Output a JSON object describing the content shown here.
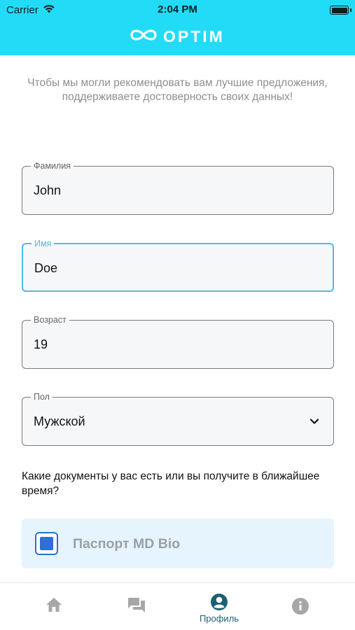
{
  "status_bar": {
    "carrier": "Carrier",
    "time": "2:04 PM"
  },
  "header": {
    "logo_text": "OPTIM"
  },
  "intro_text": "Чтобы мы могли рекомендовать вам лучшие предложения, поддерживаете достоверность своих данных!",
  "fields": {
    "surname": {
      "label": "Фамилия",
      "value": "John"
    },
    "name": {
      "label": "Имя",
      "value": "Doe"
    },
    "age": {
      "label": "Возраст",
      "value": "19"
    },
    "gender": {
      "label": "Пол",
      "value": "Мужской"
    }
  },
  "documents": {
    "question": "Какие документы у вас есть или вы получите в ближайшее время?",
    "items": [
      {
        "label": "Паспорт MD Bio",
        "checked": true
      }
    ]
  },
  "tabbar": {
    "items": [
      {
        "icon": "home-icon",
        "label": ""
      },
      {
        "icon": "chat-icon",
        "label": ""
      },
      {
        "icon": "profile-icon",
        "label": "Профиль",
        "active": true
      },
      {
        "icon": "info-icon",
        "label": ""
      }
    ]
  },
  "colors": {
    "header": "#22dcf7",
    "focus": "#4fb8f0",
    "accent": "#1d5f72",
    "checkbox": "#2f6fd6",
    "card": "#e5f4fd"
  }
}
